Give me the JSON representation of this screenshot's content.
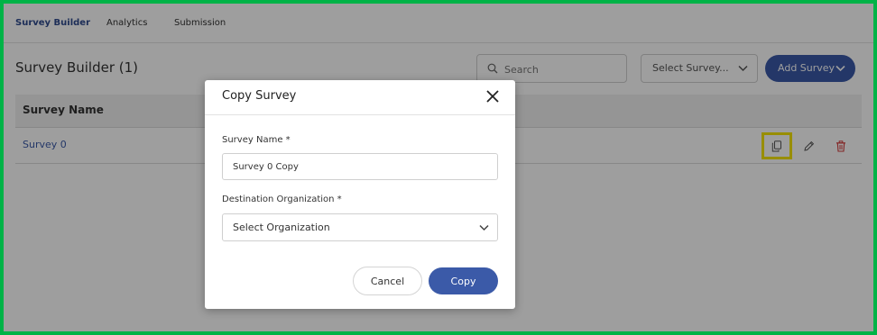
{
  "nav": {
    "tabs": [
      {
        "label": "Survey Builder",
        "active": true
      },
      {
        "label": "Analytics",
        "active": false
      },
      {
        "label": "Submission",
        "active": false
      }
    ]
  },
  "page": {
    "title": "Survey Builder  (1)"
  },
  "toolbar": {
    "search_placeholder": "Search",
    "select_survey_label": "Select Survey...",
    "add_survey_label": "Add Survey"
  },
  "table": {
    "columns": [
      "Survey Name"
    ],
    "rows": [
      {
        "name": "Survey 0",
        "actions": [
          "copy-icon",
          "edit-icon",
          "delete-icon"
        ]
      }
    ]
  },
  "modal": {
    "title": "Copy Survey",
    "survey_name_label": "Survey Name *",
    "survey_name_value": "Survey 0 Copy",
    "org_label": "Destination Organization *",
    "org_value": "Select Organization",
    "cancel_label": "Cancel",
    "copy_label": "Copy"
  },
  "colors": {
    "accent": "#3b5aa8",
    "frame": "#00b347",
    "highlight": "#f5e600",
    "delete": "#d43c3c"
  }
}
